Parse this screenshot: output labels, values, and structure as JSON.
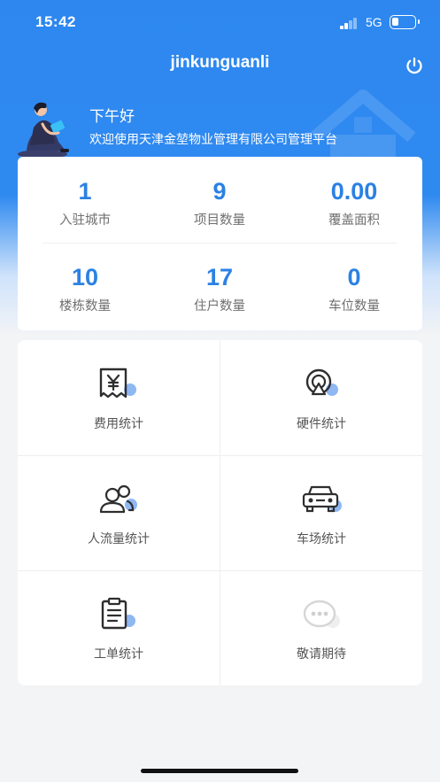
{
  "status_bar": {
    "time": "15:42",
    "network": "5G",
    "battery_level": 0.3
  },
  "header": {
    "title": "jinkunguanli"
  },
  "banner": {
    "greeting": "下午好",
    "welcome": "欢迎使用天津金堃物业管理有限公司管理平台"
  },
  "stats": [
    {
      "value": "1",
      "label": "入驻城市"
    },
    {
      "value": "9",
      "label": "项目数量"
    },
    {
      "value": "0.00",
      "label": "覆盖面积"
    },
    {
      "value": "10",
      "label": "楼栋数量"
    },
    {
      "value": "17",
      "label": "住户数量"
    },
    {
      "value": "0",
      "label": "车位数量"
    }
  ],
  "menu": [
    {
      "label": "费用统计",
      "icon": "fee-receipt-icon"
    },
    {
      "label": "硬件统计",
      "icon": "hardware-icon"
    },
    {
      "label": "人流量统计",
      "icon": "people-flow-icon"
    },
    {
      "label": "车场统计",
      "icon": "car-icon"
    },
    {
      "label": "工单统计",
      "icon": "clipboard-icon"
    },
    {
      "label": "敬请期待",
      "icon": "more-dots-icon"
    }
  ],
  "colors": {
    "primary": "#2d87ef",
    "stat_value": "#2b81e4",
    "icon_dark": "#2e2e2e",
    "icon_accent": "#8fb7f2",
    "disabled": "#d6d6d6"
  }
}
